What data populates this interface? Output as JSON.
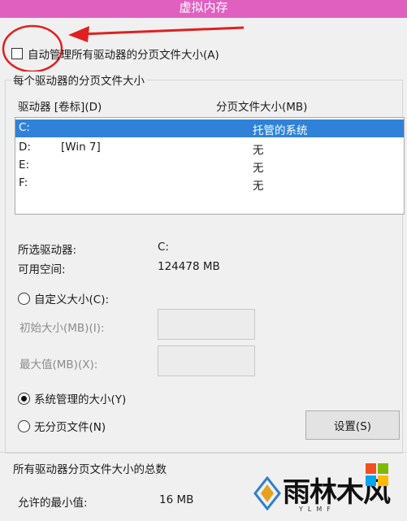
{
  "window": {
    "title": "虚拟内存"
  },
  "auto_manage": {
    "label": "自动管理所有驱动器的分页文件大小(A)",
    "checked": false
  },
  "per_drive": {
    "group_title": "每个驱动器的分页文件大小",
    "col_drive": "驱动器 [卷标](D)",
    "col_size": "分页文件大小(MB)",
    "rows": [
      {
        "drive": "C:",
        "label": "",
        "size": "托管的系统",
        "selected": true
      },
      {
        "drive": "D:",
        "label": "[Win 7]",
        "size": "无",
        "selected": false
      },
      {
        "drive": "E:",
        "label": "",
        "size": "无",
        "selected": false
      },
      {
        "drive": "F:",
        "label": "",
        "size": "无",
        "selected": false
      }
    ],
    "selected_drive_label": "所选驱动器:",
    "selected_drive_value": "C:",
    "free_space_label": "可用空间:",
    "free_space_value": "124478 MB",
    "custom_size_label": "自定义大小(C):",
    "initial_size_label": "初始大小(MB)(I):",
    "max_size_label": "最大值(MB)(X):",
    "system_managed_label": "系统管理的大小(Y)",
    "no_paging_label": "无分页文件(N)",
    "set_button": "设置(S)",
    "selected_option": "system_managed"
  },
  "totals": {
    "group_title": "所有驱动器分页文件大小的总数",
    "min_allowed_label": "允许的最小值:",
    "min_allowed_value": "16 MB"
  },
  "watermark": {
    "text": "雨林木风",
    "sub": "YLMF"
  },
  "colors": {
    "titlebar": "#e060c0",
    "selection": "#2f82d8",
    "annotation": "#e02020"
  }
}
